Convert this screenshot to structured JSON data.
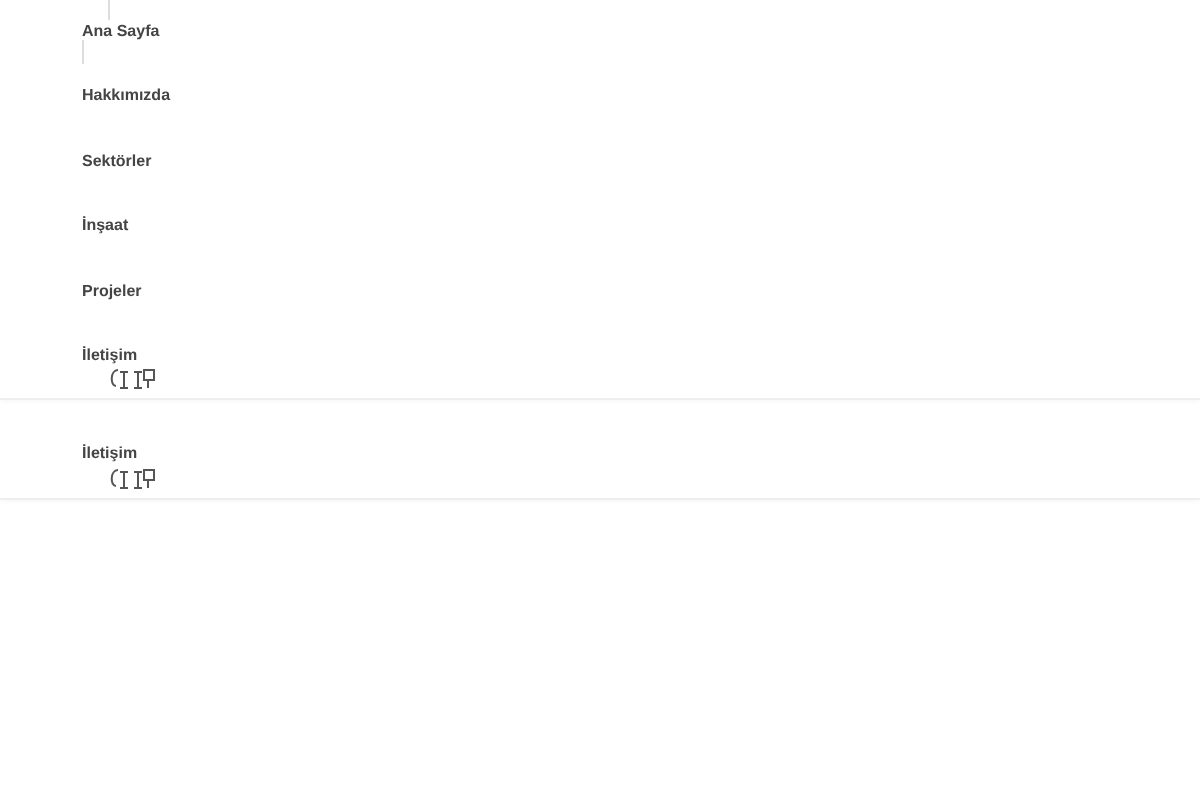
{
  "menu": {
    "items": [
      {
        "label": "Ana Sayfa"
      },
      {
        "label": "Hakkımızda"
      },
      {
        "label": "Sektörler"
      },
      {
        "label": "İnşaat"
      },
      {
        "label": "Projeler"
      },
      {
        "label": "İletişim"
      }
    ]
  },
  "sticky_menu": {
    "items": [
      {
        "label": "İletişim"
      }
    ]
  }
}
